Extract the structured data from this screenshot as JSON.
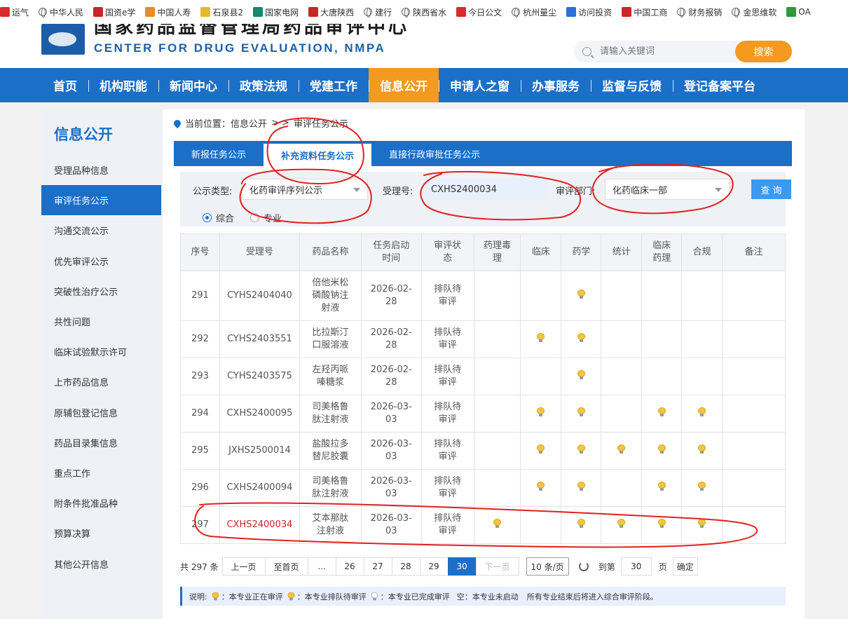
{
  "bookmarks": [
    {
      "label": "运气",
      "icon": "zhong-icon",
      "color": "#d92b2b"
    },
    {
      "label": "中华人民",
      "icon": "globe-icon"
    },
    {
      "label": "国资e学",
      "icon": "sasac-icon",
      "color": "#c62828"
    },
    {
      "label": "中国人寿",
      "icon": "chinalife-icon",
      "color": "#e8892b"
    },
    {
      "label": "石泉县2",
      "icon": "star-icon",
      "color": "#e8b82b"
    },
    {
      "label": "国家电网",
      "icon": "sgcc-icon",
      "color": "#138a6b"
    },
    {
      "label": "大唐陕西",
      "icon": "datang-icon",
      "color": "#c62828"
    },
    {
      "label": "建行",
      "icon": "globe-icon"
    },
    {
      "label": "陕西省水",
      "icon": "globe-icon"
    },
    {
      "label": "今日公文",
      "icon": "jinri-icon",
      "color": "#d92b2b"
    },
    {
      "label": "杭州量尘",
      "icon": "globe-icon"
    },
    {
      "label": "访问投资",
      "icon": "visit-icon",
      "color": "#2b6fd9"
    },
    {
      "label": "中国工商",
      "icon": "icbc-icon",
      "color": "#c62828"
    },
    {
      "label": "财务报销",
      "icon": "globe-icon"
    },
    {
      "label": "金思维软",
      "icon": "globe-icon"
    },
    {
      "label": "OA",
      "icon": "oa-icon",
      "color": "#2b9a3b"
    }
  ],
  "header": {
    "site_en": "CENTER FOR DRUG EVALUATION, NMPA",
    "site_cn": "国家药品监督管理局药品审评中心",
    "search_placeholder": "请输入关键词",
    "search_button": "搜索"
  },
  "nav": [
    "首页",
    "机构职能",
    "新闻中心",
    "政策法规",
    "党建工作",
    "信息公开",
    "申请人之窗",
    "办事服务",
    "监督与反馈",
    "登记备案平台"
  ],
  "nav_active": "信息公开",
  "sidebar": {
    "title": "信息公开",
    "items": [
      "受理品种信息",
      "审评任务公示",
      "沟通交流公示",
      "优先审评公示",
      "突破性治疗公示",
      "共性问题",
      "临床试验默示许可",
      "上市药品信息",
      "原辅包登记信息",
      "药品目录集信息",
      "重点工作",
      "附条件批准品种",
      "预算决算",
      "其他公开信息"
    ],
    "active": "审评任务公示"
  },
  "breadcrumb": {
    "prefix": "当前位置：",
    "path": "信息公开",
    "sep": "> >",
    "current": "审评任务公示"
  },
  "tabs": [
    "新报任务公示",
    "补充资料任务公示",
    "直接行政审批任务公示"
  ],
  "tab_active": "补充资料任务公示",
  "filter": {
    "type_label": "公示类型:",
    "type_value": "化药审评序列公示",
    "accept_label": "受理号:",
    "accept_value": "CXHS2400034",
    "dept_label": "审评部门:",
    "dept_value": "化药临床一部",
    "query_button": "查 询",
    "radio_options": [
      "综合",
      "专业"
    ],
    "radio_selected": "综合"
  },
  "table": {
    "headers": [
      "序号",
      "受理号",
      "药品名称",
      "任务启动时间",
      "审评状态",
      "药理毒理",
      "临床",
      "药学",
      "统计",
      "临床药理",
      "合规",
      "备注"
    ],
    "header_display": [
      "序号",
      "受理号",
      "药品名称",
      "任务启动\n时间",
      "审评状\n态",
      "药理毒\n理",
      "临床",
      "药学",
      "统计",
      "临床\n药理",
      "合规",
      "备注"
    ],
    "rows": [
      {
        "no": "291",
        "accept": "CYHS2404040",
        "drug": "倍他米松磷酸钠注射液",
        "drug_display": "倍他米松\n磷酸钠注\n射液",
        "date": "2026-02-28",
        "date_display": "2026-02-\n28",
        "status": "排队待审评",
        "status_display": "排队待\n审评",
        "bulbs": [
          false,
          false,
          true,
          false,
          false,
          false
        ]
      },
      {
        "no": "292",
        "accept": "CYHS2403551",
        "drug": "比拉斯汀口服溶液",
        "drug_display": "比拉斯汀\n口服溶液",
        "date": "2026-02-28",
        "date_display": "2026-02-\n28",
        "status": "排队待审评",
        "status_display": "排队待\n审评",
        "bulbs": [
          false,
          true,
          true,
          false,
          false,
          false
        ]
      },
      {
        "no": "293",
        "accept": "CYHS2403575",
        "drug": "左羟丙哌嗪糖浆",
        "drug_display": "左羟丙哌\n嗪糖浆",
        "date": "2026-02-28",
        "date_display": "2026-02-\n28",
        "status": "排队待审评",
        "status_display": "排队待\n审评",
        "bulbs": [
          false,
          false,
          true,
          false,
          false,
          false
        ]
      },
      {
        "no": "294",
        "accept": "CXHS2400095",
        "drug": "司美格鲁肽注射液",
        "drug_display": "司美格鲁\n肽注射液",
        "date": "2026-03-03",
        "date_display": "2026-03-\n03",
        "status": "排队待审评",
        "status_display": "排队待\n审评",
        "bulbs": [
          false,
          true,
          true,
          false,
          true,
          true
        ]
      },
      {
        "no": "295",
        "accept": "JXHS2500014",
        "drug": "盐酸拉多替尼胶囊",
        "drug_display": "盐酸拉多\n替尼胶囊",
        "date": "2026-03-03",
        "date_display": "2026-03-\n03",
        "status": "排队待审评",
        "status_display": "排队待\n审评",
        "bulbs": [
          false,
          true,
          true,
          true,
          true,
          true
        ]
      },
      {
        "no": "296",
        "accept": "CXHS2400094",
        "drug": "司美格鲁肽注射液",
        "drug_display": "司美格鲁\n肽注射液",
        "date": "2026-03-03",
        "date_display": "2026-03-\n03",
        "status": "排队待审评",
        "status_display": "排队待\n审评",
        "bulbs": [
          false,
          true,
          true,
          false,
          true,
          true
        ]
      },
      {
        "no": "297",
        "accept": "CXHS2400034",
        "drug": "艾本那肽注射液",
        "drug_display": "艾本那肽\n注射液",
        "date": "2026-03-03",
        "date_display": "2026-03-\n03",
        "status": "排队待审评",
        "status_display": "排队待\n审评",
        "bulbs": [
          true,
          false,
          true,
          true,
          true,
          true
        ],
        "highlight": true
      }
    ]
  },
  "pager": {
    "total": "共 297 条",
    "prev": "上一页",
    "first": "至首页",
    "ellipsis": "...",
    "pages": [
      "26",
      "27",
      "28",
      "29",
      "30"
    ],
    "current": "30",
    "next": "下一页",
    "page_size": "10 条/页",
    "goto_label": "到第",
    "goto_value": "30",
    "page_unit": "页",
    "confirm": "确定"
  },
  "legend": {
    "prefix": "说明:",
    "active": "本专业正在审评",
    "queued": "本专业排队待审评",
    "done": "本专业已完成审评",
    "empty": "空：本专业未启动",
    "note": "所有专业结束后将进入综合审评阶段。"
  },
  "colors": {
    "brand_blue": "#1b6fc7",
    "accent_orange": "#f39a1f",
    "annotation_red": "#e02020"
  }
}
